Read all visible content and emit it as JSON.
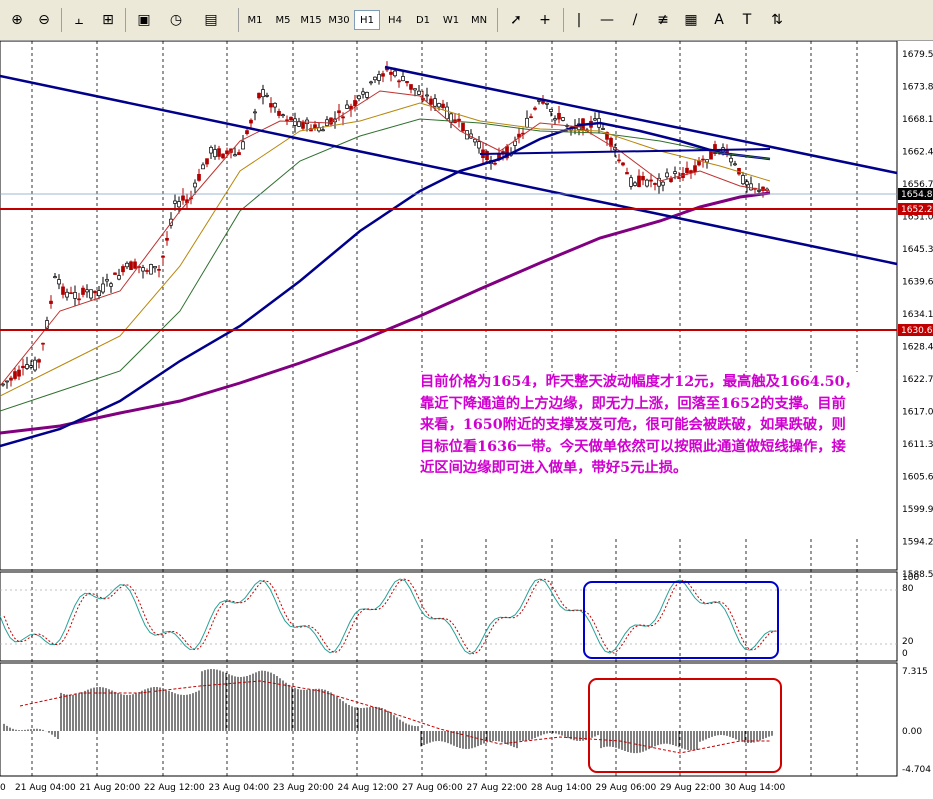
{
  "toolbar": {
    "timeframes": [
      "M1",
      "M5",
      "M15",
      "M30",
      "H1",
      "H4",
      "D1",
      "W1",
      "MN"
    ],
    "active_timeframe": "H1",
    "icons": [
      "zoom-in-icon",
      "zoom-out-icon",
      "chart-bars-icon",
      "period-separator-icon",
      "new-order-icon",
      "history-clock-icon",
      "templates-icon",
      "cursor-icon",
      "crosshair-icon",
      "vertical-line-icon",
      "horizontal-line-icon",
      "trendline-icon",
      "fibonacci-icon",
      "equidistant-channel-icon",
      "text-label-icon",
      "text-box-icon",
      "arrows-icon"
    ],
    "text_tool_label": "A",
    "textbox_tool_label": "T"
  },
  "price_axis": {
    "ticks": [
      "1679.55",
      "1673.85",
      "1668.15",
      "1662.45",
      "1656.75",
      "1651.05",
      "1645.35",
      "1639.65",
      "1634.10",
      "1628.40",
      "1622.70",
      "1617.00",
      "1611.30",
      "1605.60",
      "1599.90",
      "1594.20",
      "1588.50"
    ],
    "current_price": "1654.80",
    "support_label": "1652.20",
    "level2_label": "1630.60"
  },
  "stoch_axis": {
    "ticks": [
      "100",
      "80",
      "20",
      "0"
    ]
  },
  "macd_axis": {
    "ticks": [
      "7.315",
      "0.00",
      "-4.704"
    ]
  },
  "time_axis": {
    "labels": [
      "21 Aug 04:00",
      "21 Aug 20:00",
      "22 Aug 12:00",
      "23 Aug 04:00",
      "23 Aug 20:00",
      "24 Aug 12:00",
      "27 Aug 06:00",
      "27 Aug 22:00",
      "28 Aug 14:00",
      "29 Aug 06:00",
      "29 Aug 22:00",
      "30 Aug 14:00"
    ],
    "edge_label": "0"
  },
  "annotation": {
    "text": "目前价格为1654，昨天整天波动幅度才12元，最高触及1664.50，靠近下降通道的上方边缘，即无力上涨，回落至1652的支撑。目前来看，1650附近的支撑岌岌可危，很可能会被跌破，如果跌破，则目标位看1636一带。今天做单依然可以按照此通道做短线操作，接近区间边缘即可进入做单，带好5元止损。"
  },
  "colors": {
    "channel": "#00008b",
    "ma_slow": "#800080",
    "support": "#c00000",
    "annotation_text": "#d000d0",
    "stoch_box": "#0000cc",
    "macd_box": "#d00000"
  }
}
